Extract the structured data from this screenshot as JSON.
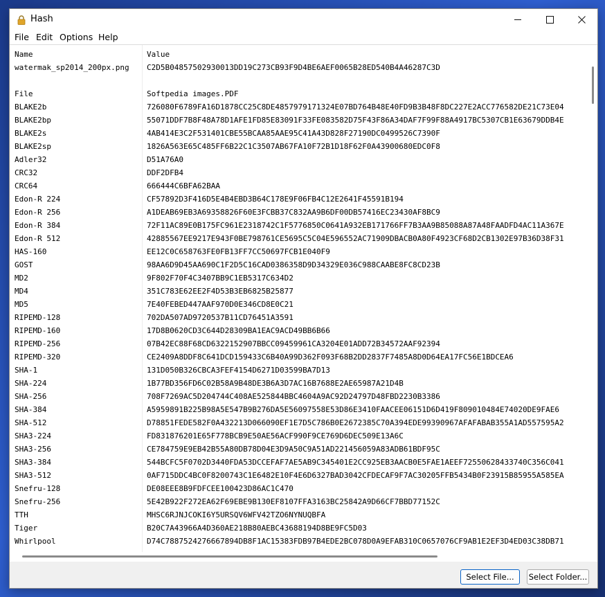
{
  "window": {
    "title": "Hash",
    "icon": "lock-icon"
  },
  "menu": [
    "File",
    "Edit",
    "Options",
    "Help"
  ],
  "columns": {
    "name": "Name",
    "value": "Value"
  },
  "rows": [
    {
      "name": "watermak_sp2014_200px.png",
      "value": "C2D5B04857502930013DD19C273CB93F9D4BE6AEF0065B28ED540B4A46287C3D"
    },
    {
      "name": "",
      "value": ""
    },
    {
      "name": "File",
      "value": "Softpedia images.PDF"
    },
    {
      "name": "BLAKE2b",
      "value": "726080F6789FA16D1878CC25C8DE4857979171324E07BD764B48E40FD9B3B48F8DC227E2ACC776582DE21C73E04"
    },
    {
      "name": "BLAKE2bp",
      "value": "55071DDF7B8F48A78D1AFE1FD85E83091F33FE083582D75F43F86A34DAF7F99F88A4917BC5307CB1E63679DDB4E"
    },
    {
      "name": "BLAKE2s",
      "value": "4AB414E3C2F531401CBE55BCAA85AAE95C41A43D828F27190DC0499526C7390F"
    },
    {
      "name": "BLAKE2sp",
      "value": "1826A563E65C485FF6B22C1C3507AB67FA10F72B1D18F62F0A43900680EDC0F8"
    },
    {
      "name": "Adler32",
      "value": "D51A76A0"
    },
    {
      "name": "CRC32",
      "value": "DDF2DFB4"
    },
    {
      "name": "CRC64",
      "value": "666444C6BFA62BAA"
    },
    {
      "name": "Edon-R 224",
      "value": "CF57892D3F416D5E4B4EBD3B64C178E9F06FB4C12E2641F45591B194"
    },
    {
      "name": "Edon-R 256",
      "value": "A1DEAB69EB3A69358826F60E3FCBB37C832AA9B6DF00DB57416EC23430AF8BC9"
    },
    {
      "name": "Edon-R 384",
      "value": "72F11AC89E0B175FC961E2318742C1F5776850C0641A932EB171766FF7B3AA9B85088A87A48FAADFD4AC11A367E"
    },
    {
      "name": "Edon-R 512",
      "value": "42885567EE9217E943F0BE798761CE5695C5C04E596552AC71909DBACB0A80F4923CF68D2CB1302E97B36D38F31"
    },
    {
      "name": "HAS-160",
      "value": "EE12C0C658763FE0FB13FF7CC50697FCB1E040F9"
    },
    {
      "name": "GOST",
      "value": "98AA6D9D45AA690C1F2D5C16CAD0386358D9D34329E036C988CAABE8FC8CD23B"
    },
    {
      "name": "MD2",
      "value": "9F802F70F4C3407BB9C1EB5317C634D2"
    },
    {
      "name": "MD4",
      "value": "351C783E62EE2F4D53B3EB6825B25877"
    },
    {
      "name": "MD5",
      "value": "7E40FEBED447AAF970D0E346CD8E0C21"
    },
    {
      "name": "RIPEMD-128",
      "value": "702DA507AD9720537B11CD76451A3591"
    },
    {
      "name": "RIPEMD-160",
      "value": "17D8B0620CD3C644D28309BA1EAC9ACD49BB6B66"
    },
    {
      "name": "RIPEMD-256",
      "value": "07B42EC88F68CD6322152907BBCC09459961CA3204E01ADD72B34572AAF92394"
    },
    {
      "name": "RIPEMD-320",
      "value": "CE2409A8DDF8C641DCD159433C6B40A99D362F093F68B2DD2837F7485A8D0D64EA17FC56E1BDCEA6"
    },
    {
      "name": "SHA-1",
      "value": "131D050B326CBCA3FEF4154D6271D03599BA7D13"
    },
    {
      "name": "SHA-224",
      "value": "1B77BD356FD6C02B58A9B48DE3B6A3D7AC16B7688E2AE65987A21D4B"
    },
    {
      "name": "SHA-256",
      "value": "708F7269AC5D204744C408AE525844BBC4604A9AC92D24797D48FBD2230B3386"
    },
    {
      "name": "SHA-384",
      "value": "A5959891B225B98A5E547B9B276DA5E56097558E53D86E3410FAACEE06151D6D419F809010484E74020DE9FAE6"
    },
    {
      "name": "SHA-512",
      "value": "D78851FEDE582F0A432213D066090EF1E7D5C786B0E2672385C70A394EDE99390967AFAFABAB355A1AD557595A2"
    },
    {
      "name": "SHA3-224",
      "value": "FD831876201E65F778BCB9E50AE56ACF990F9CE769D6DEC509E13A6C"
    },
    {
      "name": "SHA3-256",
      "value": "CE784759E9EB42B55A80DB78D04E3D9A50C9A51AD221456059A83ADB61BDF95C"
    },
    {
      "name": "SHA3-384",
      "value": "544BCFC5F0702D3440FDA53DCCEFAF7AE5AB9C345401E2CC925EB3AACB0E5FAE1AEEF72550628433740C356C041"
    },
    {
      "name": "SHA3-512",
      "value": "0AF715DDC4BC0F8200743C1E6482E10F4E6D6327BAD3042CFDECAF9F7AC30205FFB5434B0F23915B85955A585EA"
    },
    {
      "name": "Snefru-128",
      "value": "DE08EEE8B9FDFCEE100423D86AC1C470"
    },
    {
      "name": "Snefru-256",
      "value": "5E42B922F272EA62F69EBE9B130EF8107FFA3163BC25842A9D66CF7BBD77152C"
    },
    {
      "name": "TTH",
      "value": "MHSC6RJNJCOKI6Y5URSQV6WFV42TZO6NYNUQBFA"
    },
    {
      "name": "Tiger",
      "value": "B20C7A43966A4D360AE218B80AEBC43688194D8BE9FC5D03"
    },
    {
      "name": "Whirlpool",
      "value": "D74C7887524276667894DB8F1AC15383FDB97B4EDE2BC078D0A9EFAB310C0657076CF9AB1E2EF3D4ED03C38DB71"
    }
  ],
  "buttons": {
    "select_file": "Select File...",
    "select_folder": "Select Folder..."
  }
}
